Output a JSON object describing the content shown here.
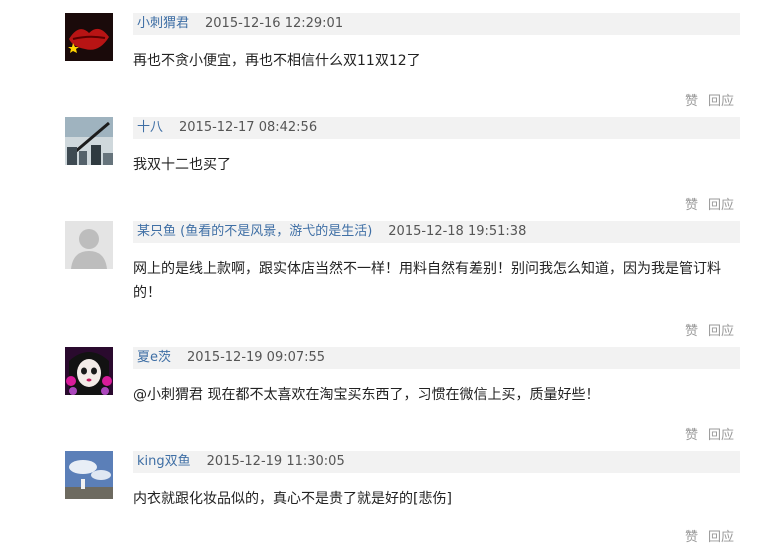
{
  "comments": [
    {
      "name": "小刺猬君",
      "time": "2015-12-16 12:29:01",
      "text": "再也不贪小便宜，再也不相信什么双11双12了",
      "like": "赞",
      "reply": "回应",
      "avatar": "red-lips-avatar"
    },
    {
      "name": "十八",
      "time": "2015-12-17 08:42:56",
      "text": "我双十二也买了",
      "like": "赞",
      "reply": "回应",
      "avatar": "city-photo-avatar"
    },
    {
      "name": "某只鱼 (鱼看的不是风景，游弋的是生活)",
      "time": "2015-12-18 19:51:38",
      "text": "网上的是线上款啊，跟实体店当然不一样！用料自然有差别！别问我怎么知道，因为我是管订料的！",
      "like": "赞",
      "reply": "回应",
      "avatar": "default-user-avatar"
    },
    {
      "name": "夏e茨",
      "time": "2015-12-19 09:07:55",
      "text": "@小刺猬君 现在都不太喜欢在淘宝买东西了，习惯在微信上买，质量好些！",
      "like": "赞",
      "reply": "回应",
      "avatar": "doll-face-avatar"
    },
    {
      "name": "king双鱼",
      "time": "2015-12-19 11:30:05",
      "text": "内衣就跟化妆品似的，真心不是贵了就是好的[悲伤]",
      "like": "赞",
      "reply": "回应",
      "avatar": "sky-photo-avatar"
    }
  ],
  "colors": {
    "name_link": "#3f6fa5",
    "meta_bg": "#f2f2f2",
    "action_text": "#999999"
  }
}
